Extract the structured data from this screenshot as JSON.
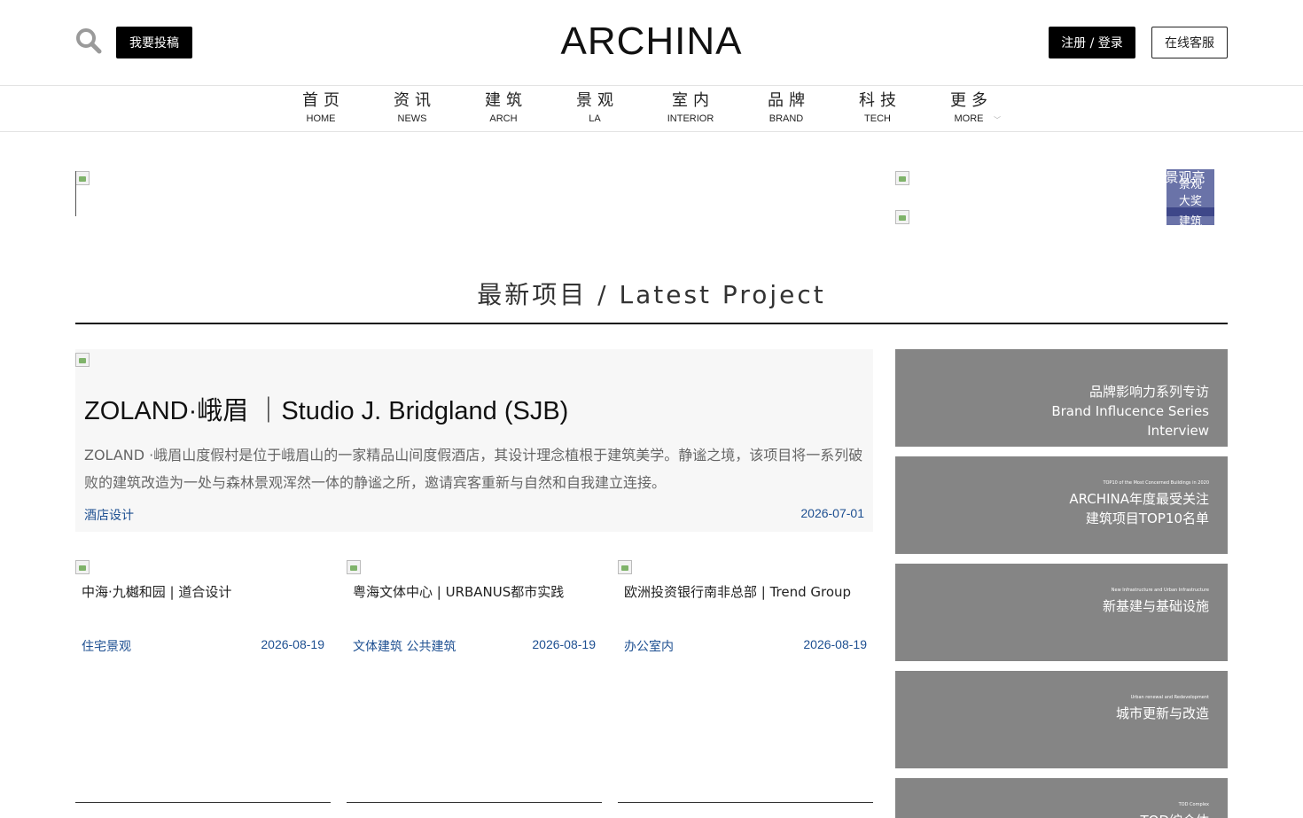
{
  "header": {
    "logo": "ARCHINA",
    "submit_label": "我要投稿",
    "login_label": "注册 / 登录",
    "service_label": "在线客服",
    "search_icon": "search-icon"
  },
  "nav": {
    "items": [
      {
        "zh": "首页",
        "en": "HOME"
      },
      {
        "zh": "资讯",
        "en": "NEWS"
      },
      {
        "zh": "建筑",
        "en": "ARCH"
      },
      {
        "zh": "景观",
        "en": "LA"
      },
      {
        "zh": "室内",
        "en": "INTERIOR"
      },
      {
        "zh": "品牌",
        "en": "BRAND"
      },
      {
        "zh": "科技",
        "en": "TECH"
      },
      {
        "zh": "更多",
        "en": "MORE"
      }
    ]
  },
  "side_tags": [
    "景观",
    "大奖",
    "建筑",
    "景观亮"
  ],
  "section": {
    "title": "最新项目 / Latest Project"
  },
  "featured": {
    "title": "ZOLAND·峨眉 ｜Studio J. Bridgland (SJB)",
    "description": "ZOLAND ·峨眉山度假村是位于峨眉山的一家精品山间度假酒店，其设计理念植根于建筑美学。静谧之境，该项目将一系列破败的建筑改造为一处与森林景观浑然一体的静谧之所，邀请宾客重新与自然和自我建立连接。",
    "tag": "酒店设计",
    "date": "2026-07-01"
  },
  "cards": [
    {
      "title": "中海·九樾和园 | 道合设计",
      "tag": "住宅景观",
      "date": "2026-08-19"
    },
    {
      "title": "粤海文体中心 | URBANUS都市实践",
      "tag": "文体建筑 公共建筑",
      "date": "2026-08-19"
    },
    {
      "title": "欧洲投资银行南非总部 | Trend Group",
      "tag": "办公室内",
      "date": "2026-08-19"
    }
  ],
  "panels": [
    {
      "small": "",
      "lines": [
        "品牌影响力系列专访",
        "Brand Influcence Series",
        "Interview"
      ]
    },
    {
      "small": "TOP10 of the Most Concerned Buildings in 2020",
      "lines": [
        "ARCHINA年度最受关注",
        "建筑项目TOP10名单"
      ]
    },
    {
      "small": "New Infrastructure and Urban Infrastructure",
      "lines": [
        "新基建与基础设施"
      ]
    },
    {
      "small": "Urban renewal and Redevelopment",
      "lines": [
        "城市更新与改造"
      ]
    },
    {
      "small": "TOD Complex",
      "lines": [
        "TOD综合体"
      ]
    }
  ],
  "colors": {
    "panel_bg": "#858585",
    "tag_blue": "#1d4f91",
    "tag_purple": "#6a73a8"
  }
}
